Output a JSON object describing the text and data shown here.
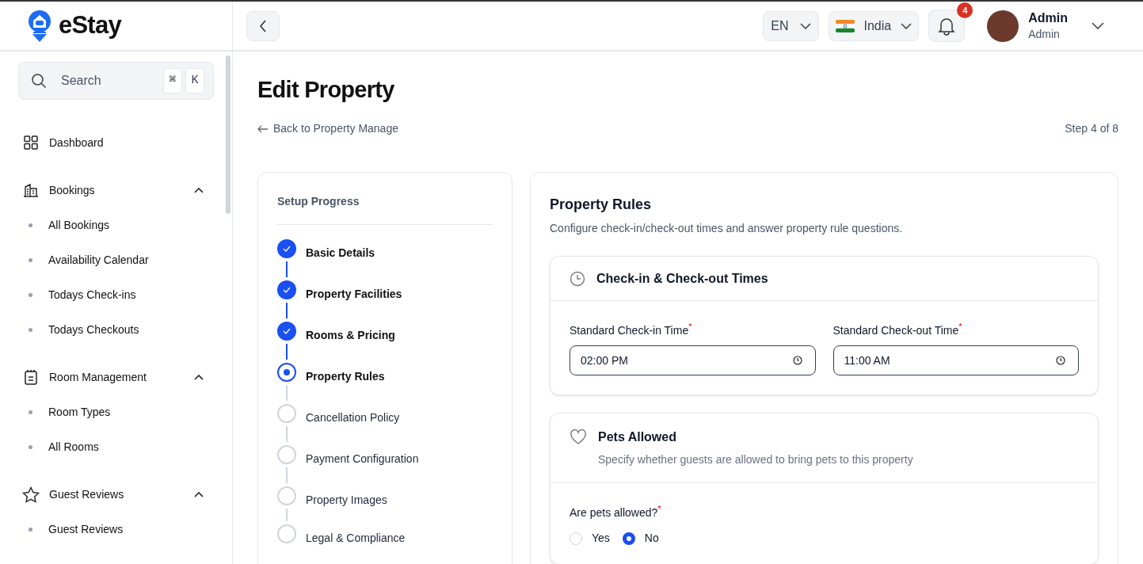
{
  "brand": {
    "name": "eStay"
  },
  "search": {
    "placeholder": "Search",
    "shortcut_keys": [
      "⌘",
      "K"
    ]
  },
  "sidebar": {
    "items": [
      {
        "kind": "link",
        "label": "Dashboard"
      },
      {
        "kind": "group",
        "label": "Bookings",
        "expanded": true,
        "children": [
          {
            "label": "All Bookings"
          },
          {
            "label": "Availability Calendar"
          },
          {
            "label": "Todays Check-ins"
          },
          {
            "label": "Todays Checkouts"
          }
        ]
      },
      {
        "kind": "group",
        "label": "Room Management",
        "expanded": true,
        "children": [
          {
            "label": "Room Types"
          },
          {
            "label": "All Rooms"
          }
        ]
      },
      {
        "kind": "group",
        "label": "Guest Reviews",
        "expanded": true,
        "children": [
          {
            "label": "Guest Reviews"
          }
        ]
      }
    ]
  },
  "header": {
    "language": "EN",
    "region": "India",
    "notification_count": "4",
    "user": {
      "name": "Admin",
      "role": "Admin"
    }
  },
  "page": {
    "title": "Edit Property",
    "back_link": "Back to Property Manage",
    "step": "Step 4 of 8"
  },
  "progress": {
    "title": "Setup Progress",
    "steps": [
      {
        "label": "Basic Details",
        "kind": "done"
      },
      {
        "label": "Property Facilities",
        "kind": "done"
      },
      {
        "label": "Rooms & Pricing",
        "kind": "done"
      },
      {
        "label": "Property Rules",
        "kind": "current"
      },
      {
        "label": "Cancellation Policy",
        "kind": "pending"
      },
      {
        "label": "Payment Configuration",
        "kind": "pending"
      },
      {
        "label": "Property Images",
        "kind": "pending"
      },
      {
        "label": "Legal & Compliance",
        "kind": "pending"
      }
    ]
  },
  "rules": {
    "title": "Property Rules",
    "description": "Configure check-in/check-out times and answer property rule questions.",
    "times": {
      "title": "Check-in & Check-out Times",
      "fields": [
        {
          "label": "Standard Check-in Time",
          "required_mark": "*",
          "value": "02:00 PM"
        },
        {
          "label": "Standard Check-out Time",
          "required_mark": "*",
          "value": "11:00 AM"
        }
      ]
    },
    "pets": {
      "title": "Pets Allowed",
      "description": "Specify whether guests are allowed to bring pets to this property",
      "question": "Are pets allowed?",
      "required_mark": "*",
      "options": [
        {
          "label": "Yes",
          "selected": false
        },
        {
          "label": "No",
          "selected": true
        }
      ]
    }
  }
}
